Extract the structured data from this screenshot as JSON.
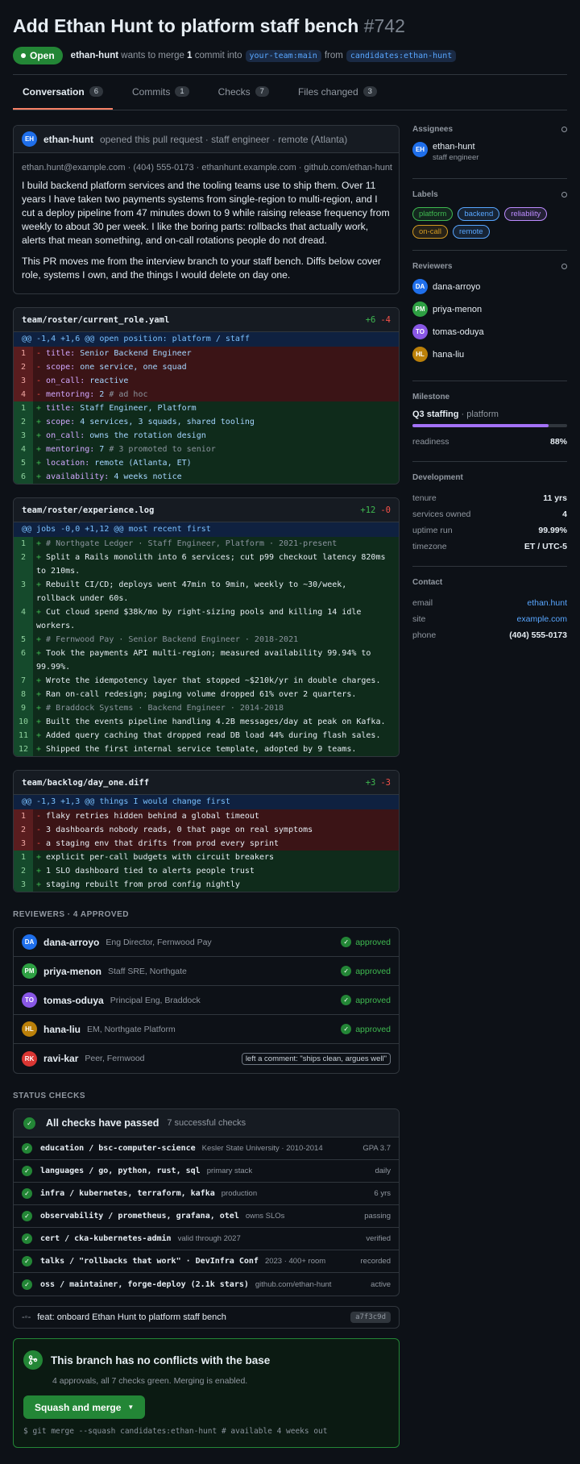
{
  "header": {
    "title": "Add Ethan Hunt to platform staff bench",
    "number": "#742",
    "status": "Open",
    "author": "ethan-hunt",
    "merge_text_1": "wants to merge",
    "commits": "1",
    "merge_text_2": "commit into",
    "base": "your-team:main",
    "from": "from",
    "head": "candidates:ethan-hunt"
  },
  "tabs": [
    {
      "label": "Conversation",
      "count": "6"
    },
    {
      "label": "Commits",
      "count": "1"
    },
    {
      "label": "Checks",
      "count": "7"
    },
    {
      "label": "Files changed",
      "count": "3"
    }
  ],
  "opening": {
    "initials": "EH",
    "author": "ethan-hunt",
    "desc": "opened this pull request · staff engineer · remote (Atlanta)",
    "contact": "ethan.hunt@example.com · (404) 555-0173 · ethanhunt.example.com · github.com/ethan-hunt",
    "p1": "I build backend platform services and the tooling teams use to ship them. Over 11 years I have taken two payments systems from single-region to multi-region, and I cut a deploy pipeline from 47 minutes down to 9 while raising release frequency from weekly to about 30 per week. I like the boring parts: rollbacks that actually work, alerts that mean something, and on-call rotations people do not dread.",
    "p2": "This PR moves me from the interview branch to your staff bench. Diffs below cover role, systems I own, and the things I would delete on day one."
  },
  "files": [
    {
      "name": "team/roster/current_role.yaml",
      "add": "+6",
      "del": "-4",
      "hunk": "@@ -1,4 +1,6 @@ open position: platform / staff",
      "lines": [
        {
          "t": "d",
          "n": "1",
          "k": "title:",
          "v": " Senior Backend Engineer",
          "c": ""
        },
        {
          "t": "d",
          "n": "2",
          "k": "scope:",
          "v": " one service, one squad",
          "c": ""
        },
        {
          "t": "d",
          "n": "3",
          "k": "on_call:",
          "v": " reactive",
          "c": ""
        },
        {
          "t": "d",
          "n": "4",
          "k": "mentoring:",
          "v": " 2",
          "c": " # ad hoc"
        },
        {
          "t": "a",
          "n": "1",
          "k": "title:",
          "v": " Staff Engineer, Platform",
          "c": ""
        },
        {
          "t": "a",
          "n": "2",
          "k": "scope:",
          "v": " 4 services, 3 squads, shared tooling",
          "c": ""
        },
        {
          "t": "a",
          "n": "3",
          "k": "on_call:",
          "v": " owns the rotation design",
          "c": ""
        },
        {
          "t": "a",
          "n": "4",
          "k": "mentoring:",
          "v": " 7",
          "c": " # 3 promoted to senior"
        },
        {
          "t": "a",
          "n": "5",
          "k": "location:",
          "v": " remote (Atlanta, ET)",
          "c": ""
        },
        {
          "t": "a",
          "n": "6",
          "k": "availability:",
          "v": " 4 weeks notice",
          "c": ""
        }
      ]
    },
    {
      "name": "team/roster/experience.log",
      "add": "+12",
      "del": "-0",
      "hunk": "@@ jobs -0,0 +1,12 @@ most recent first",
      "lines": [
        {
          "t": "a",
          "n": "1",
          "k": "",
          "v": "",
          "c": "# Northgate Ledger · Staff Engineer, Platform · 2021-present"
        },
        {
          "t": "a",
          "n": "2",
          "k": "",
          "v": "Split a Rails monolith into 6 services; cut p99 checkout latency 820ms to 210ms.",
          "c": ""
        },
        {
          "t": "a",
          "n": "3",
          "k": "",
          "v": "Rebuilt CI/CD; deploys went 47min to 9min, weekly to ~30/week, rollback under 60s.",
          "c": ""
        },
        {
          "t": "a",
          "n": "4",
          "k": "",
          "v": "Cut cloud spend $38k/mo by right-sizing pools and killing 14 idle workers.",
          "c": ""
        },
        {
          "t": "a",
          "n": "5",
          "k": "",
          "v": "",
          "c": "# Fernwood Pay · Senior Backend Engineer · 2018-2021"
        },
        {
          "t": "a",
          "n": "6",
          "k": "",
          "v": "Took the payments API multi-region; measured availability 99.94% to 99.99%.",
          "c": ""
        },
        {
          "t": "a",
          "n": "7",
          "k": "",
          "v": "Wrote the idempotency layer that stopped ~$210k/yr in double charges.",
          "c": ""
        },
        {
          "t": "a",
          "n": "8",
          "k": "",
          "v": "Ran on-call redesign; paging volume dropped 61% over 2 quarters.",
          "c": ""
        },
        {
          "t": "a",
          "n": "9",
          "k": "",
          "v": "",
          "c": "# Braddock Systems · Backend Engineer · 2014-2018"
        },
        {
          "t": "a",
          "n": "10",
          "k": "",
          "v": "Built the events pipeline handling 4.2B messages/day at peak on Kafka.",
          "c": ""
        },
        {
          "t": "a",
          "n": "11",
          "k": "",
          "v": "Added query caching that dropped read DB load 44% during flash sales.",
          "c": ""
        },
        {
          "t": "a",
          "n": "12",
          "k": "",
          "v": "Shipped the first internal service template, adopted by 9 teams.",
          "c": ""
        }
      ]
    },
    {
      "name": "team/backlog/day_one.diff",
      "add": "+3",
      "del": "-3",
      "hunk": "@@ -1,3 +1,3 @@ things I would change first",
      "lines": [
        {
          "t": "d",
          "n": "1",
          "k": "",
          "v": "flaky retries hidden behind a global timeout",
          "c": ""
        },
        {
          "t": "d",
          "n": "2",
          "k": "",
          "v": "3 dashboards nobody reads, 0 that page on real symptoms",
          "c": ""
        },
        {
          "t": "d",
          "n": "3",
          "k": "",
          "v": "a staging env that drifts from prod every sprint",
          "c": ""
        },
        {
          "t": "a",
          "n": "1",
          "k": "",
          "v": "explicit per-call budgets with circuit breakers",
          "c": ""
        },
        {
          "t": "a",
          "n": "2",
          "k": "",
          "v": "1 SLO dashboard tied to alerts people trust",
          "c": ""
        },
        {
          "t": "a",
          "n": "3",
          "k": "",
          "v": "staging rebuilt from prod config nightly",
          "c": ""
        }
      ]
    }
  ],
  "reviewers_title": "REVIEWERS · 4 APPROVED",
  "reviewers": [
    {
      "initials": "DA",
      "color": "#1f6feb",
      "name": "dana-arroyo",
      "role": "Eng Director, Fernwood Pay",
      "status": "approved"
    },
    {
      "initials": "PM",
      "color": "#2ea043",
      "name": "priya-menon",
      "role": "Staff SRE, Northgate",
      "status": "approved"
    },
    {
      "initials": "TO",
      "color": "#8957e5",
      "name": "tomas-oduya",
      "role": "Principal Eng, Braddock",
      "status": "approved"
    },
    {
      "initials": "HL",
      "color": "#bb8009",
      "name": "hana-liu",
      "role": "EM, Northgate Platform",
      "status": "approved"
    },
    {
      "initials": "RK",
      "color": "#da3633",
      "name": "ravi-kar",
      "role": "Peer, Fernwood",
      "status": "left a comment: \"ships clean, argues well\""
    }
  ],
  "checks_title": "STATUS CHECKS",
  "checks_head": "All checks have passed",
  "checks_sub": "7 successful checks",
  "checks": [
    {
      "name": "education / bsc-computer-science",
      "desc": "Kesler State University · 2010-2014",
      "right": "GPA 3.7"
    },
    {
      "name": "languages / go, python, rust, sql",
      "desc": "primary stack",
      "right": "daily"
    },
    {
      "name": "infra / kubernetes, terraform, kafka",
      "desc": "production",
      "right": "6 yrs"
    },
    {
      "name": "observability / prometheus, grafana, otel",
      "desc": "owns SLOs",
      "right": "passing"
    },
    {
      "name": "cert / cka-kubernetes-admin",
      "desc": "valid through 2027",
      "right": "verified"
    },
    {
      "name": "talks / \"rollbacks that work\" · DevInfra Conf",
      "desc": "2023 · 400+ room",
      "right": "recorded"
    },
    {
      "name": "oss / maintainer, forge-deploy (2.1k stars)",
      "desc": "github.com/ethan-hunt",
      "right": "active"
    }
  ],
  "commit": {
    "msg": "feat: onboard Ethan Hunt to platform staff bench",
    "sha": "a7f3c9d"
  },
  "merge": {
    "title": "This branch has no conflicts with the base",
    "sub": "4 approvals, all 7 checks green. Merging is enabled.",
    "button": "Squash and merge",
    "cmd": "$ git merge --squash candidates:ethan-hunt # available 4 weeks out"
  },
  "sidebar": {
    "assignees_title": "Assignees",
    "assignee": {
      "initials": "EH",
      "name": "ethan-hunt",
      "role": "staff engineer"
    },
    "labels_title": "Labels",
    "labels": [
      {
        "name": "platform",
        "color": "#3fb950"
      },
      {
        "name": "backend",
        "color": "#58a6ff"
      },
      {
        "name": "reliability",
        "color": "#bc8cff"
      },
      {
        "name": "on-call",
        "color": "#d29922"
      },
      {
        "name": "remote",
        "color": "#58a6ff"
      }
    ],
    "reviewers_title": "Reviewers",
    "reviewers": [
      {
        "initials": "DA",
        "color": "#1f6feb",
        "name": "dana-arroyo"
      },
      {
        "initials": "PM",
        "color": "#2ea043",
        "name": "priya-menon"
      },
      {
        "initials": "TO",
        "color": "#8957e5",
        "name": "tomas-oduya"
      },
      {
        "initials": "HL",
        "color": "#bb8009",
        "name": "hana-liu"
      }
    ],
    "milestone_title": "Milestone",
    "milestone_name": "Q3 staffing",
    "milestone_sub": "· platform",
    "readiness_label": "readiness",
    "readiness": "88%",
    "readiness_value": 0.88,
    "dev_title": "Development",
    "dev": [
      {
        "k": "tenure",
        "v": "11 yrs"
      },
      {
        "k": "services owned",
        "v": "4"
      },
      {
        "k": "uptime run",
        "v": "99.99%"
      },
      {
        "k": "timezone",
        "v": "ET / UTC-5"
      }
    ],
    "contact_title": "Contact",
    "contact": [
      {
        "k": "email",
        "v": "ethan.hunt",
        "link": true
      },
      {
        "k": "site",
        "v": "example.com",
        "link": true
      },
      {
        "k": "phone",
        "v": "(404) 555-0173",
        "link": false
      }
    ]
  }
}
